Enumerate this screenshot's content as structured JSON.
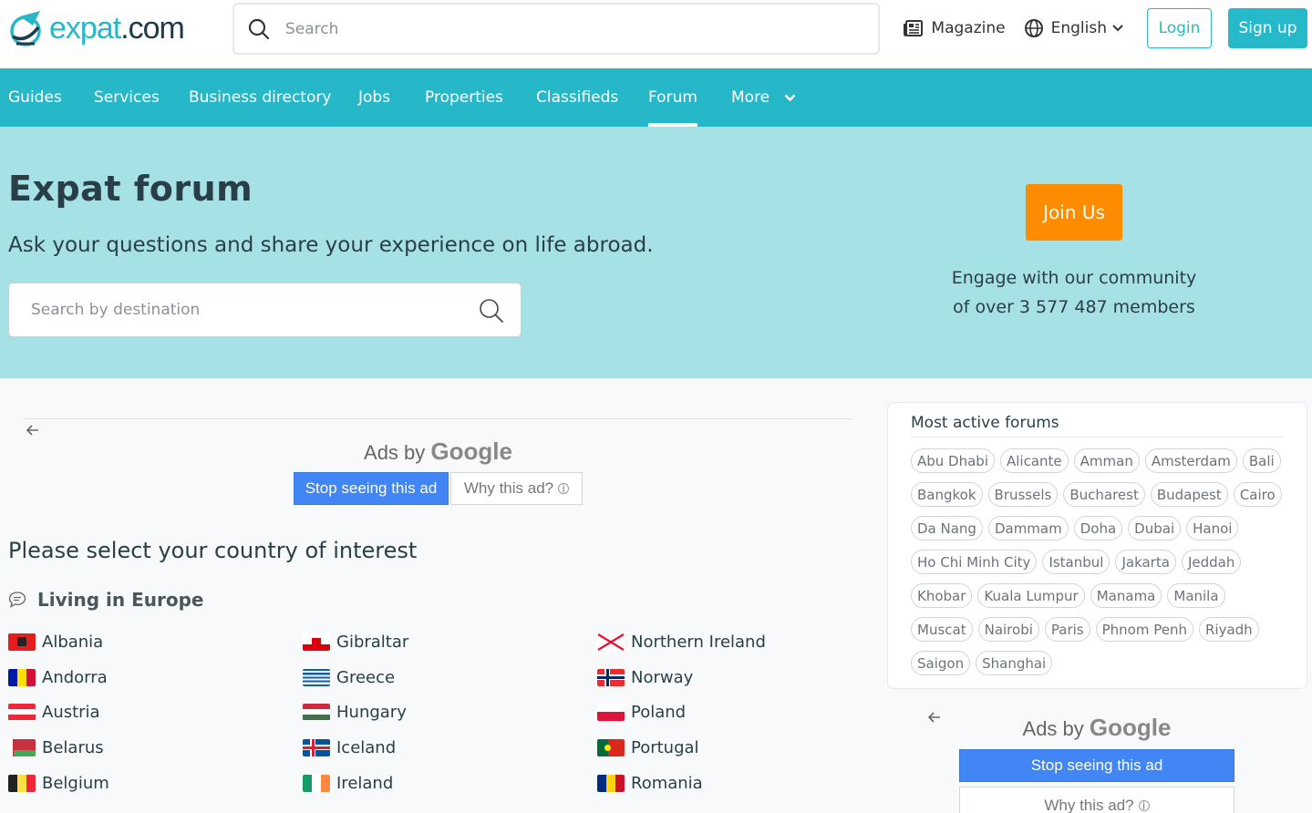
{
  "header": {
    "logo_text_brand": "expat",
    "logo_text_tld": ".com",
    "search_placeholder": "Search",
    "magazine_label": "Magazine",
    "language_label": "English",
    "login_label": "Login",
    "signup_label": "Sign up"
  },
  "nav": {
    "items": [
      {
        "label": "Guides"
      },
      {
        "label": "Services"
      },
      {
        "label": "Business directory"
      },
      {
        "label": "Jobs"
      },
      {
        "label": "Properties"
      },
      {
        "label": "Classifieds"
      },
      {
        "label": "Forum",
        "active": true
      },
      {
        "label": "More"
      }
    ]
  },
  "hero": {
    "title": "Expat forum",
    "subtitle": "Ask your questions and share your experience on life abroad.",
    "search_placeholder": "Search by destination",
    "join_label": "Join Us",
    "engage_line1": "Engage with our community",
    "engage_line2": "of over 3 577 487 members"
  },
  "ads": {
    "ads_by": "Ads by",
    "google": "Google",
    "stop_label": "Stop seeing this ad",
    "why_label": "Why this ad?",
    "info_glyph": "i"
  },
  "content": {
    "select_title": "Please select your country of interest",
    "region_title": "Living in Europe",
    "countries": [
      {
        "name": "Albania"
      },
      {
        "name": "Andorra"
      },
      {
        "name": "Austria"
      },
      {
        "name": "Belarus"
      },
      {
        "name": "Belgium"
      },
      {
        "name": "Gibraltar"
      },
      {
        "name": "Greece"
      },
      {
        "name": "Hungary"
      },
      {
        "name": "Iceland"
      },
      {
        "name": "Ireland"
      },
      {
        "name": "Northern Ireland"
      },
      {
        "name": "Norway"
      },
      {
        "name": "Poland"
      },
      {
        "name": "Portugal"
      },
      {
        "name": "Romania"
      }
    ]
  },
  "sidebar": {
    "forums_title": "Most active forums",
    "forums": [
      [
        "Abu Dhabi",
        "Alicante",
        "Amman",
        "Amsterdam",
        "Bali"
      ],
      [
        "Bangkok",
        "Brussels",
        "Bucharest",
        "Budapest",
        "Cairo"
      ],
      [
        "Da Nang",
        "Dammam",
        "Doha",
        "Dubai",
        "Hanoi"
      ],
      [
        "Ho Chi Minh City",
        "Istanbul",
        "Jakarta",
        "Jeddah"
      ],
      [
        "Khobar",
        "Kuala Lumpur",
        "Manama",
        "Manila"
      ],
      [
        "Muscat",
        "Nairobi",
        "Paris",
        "Phnom Penh",
        "Riyadh"
      ],
      [
        "Saigon",
        "Shanghai"
      ]
    ]
  },
  "colors": {
    "brand": "#26b8c9",
    "hero_bg": "#a6e1e6",
    "join": "#ff8c00",
    "google_blue": "#4285f4"
  }
}
